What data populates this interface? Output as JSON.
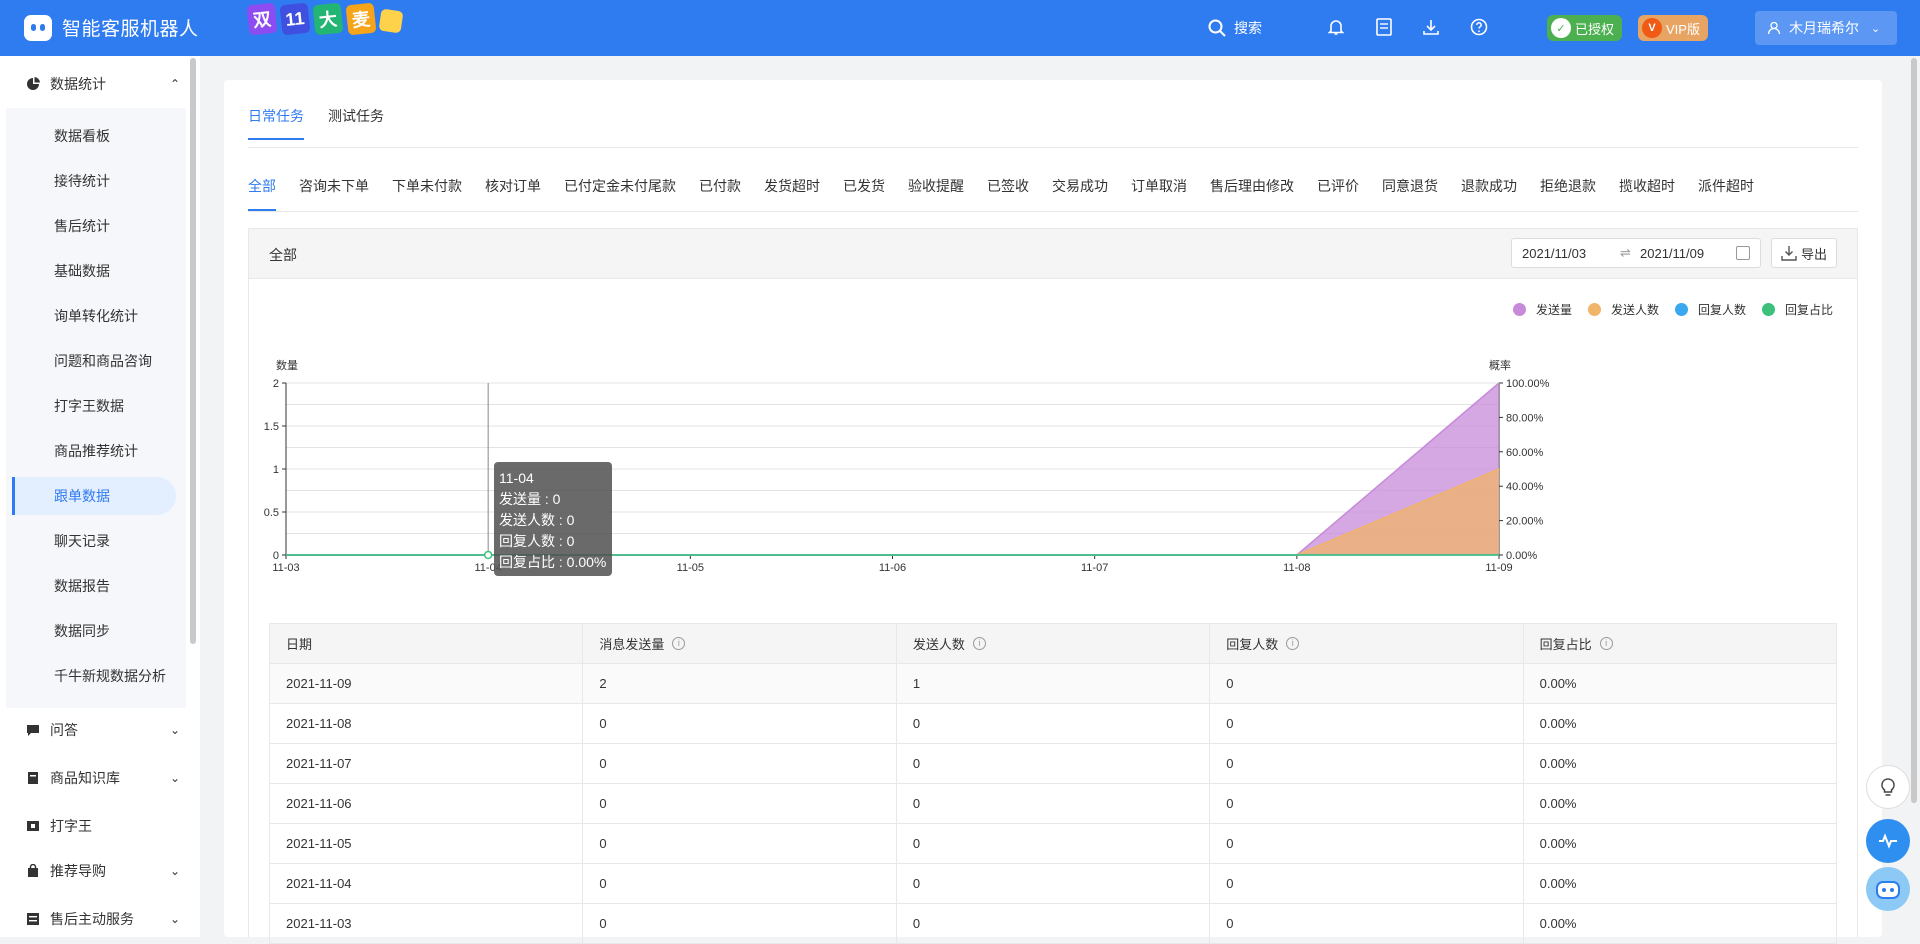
{
  "app": {
    "title": "智能客服机器人",
    "banner_chars": [
      "双",
      "11",
      "大",
      "麦"
    ]
  },
  "topbar": {
    "search_label": "搜索",
    "authorized_label": "已授权",
    "vip_label": "VIP版",
    "user_name": "木月瑞希尔"
  },
  "colors": {
    "primary": "#2f7bf0",
    "authorized": "#4caf50",
    "vip": "#f08c2e"
  },
  "sidebar": {
    "stats_group": "数据统计",
    "items": [
      "数据看板",
      "接待统计",
      "售后统计",
      "基础数据",
      "询单转化统计",
      "问题和商品咨询",
      "打字王数据",
      "商品推荐统计",
      "跟单数据",
      "聊天记录",
      "数据报告",
      "数据同步",
      "千牛新规数据分析"
    ],
    "active_index": 8,
    "groups": [
      "问答",
      "商品知识库",
      "打字王",
      "推荐导购",
      "售后主动服务"
    ]
  },
  "tabs_top": [
    "日常任务",
    "测试任务"
  ],
  "tabs_top_active": 0,
  "tabs_status": [
    "全部",
    "咨询未下单",
    "下单未付款",
    "核对订单",
    "已付定金未付尾款",
    "已付款",
    "发货超时",
    "已发货",
    "验收提醒",
    "已签收",
    "交易成功",
    "订单取消",
    "售后理由修改",
    "已评价",
    "同意退货",
    "退款成功",
    "拒绝退款",
    "揽收超时",
    "派件超时"
  ],
  "tabs_status_active": 0,
  "panel": {
    "title": "全部",
    "date_from": "2021/11/03",
    "date_to": "2021/11/09",
    "export_label": "导出"
  },
  "tooltip": {
    "title": "11-04",
    "lines": [
      "发送量 : 0",
      "发送人数 : 0",
      "回复人数 : 0",
      "回复占比 : 0.00%"
    ]
  },
  "chart_data": {
    "type": "area",
    "categories": [
      "11-03",
      "11-04",
      "11-05",
      "11-06",
      "11-07",
      "11-08",
      "11-09"
    ],
    "ylabel": "数量",
    "y2label": "概率",
    "ylim": [
      0,
      2
    ],
    "y2lim": [
      0,
      100
    ],
    "yticks": [
      "0",
      "0.5",
      "1",
      "1.5",
      "2"
    ],
    "y2ticks": [
      "0.00%",
      "20.00%",
      "40.00%",
      "60.00%",
      "80.00%",
      "100.00%"
    ],
    "legend_position": "top-right",
    "series": [
      {
        "name": "发送量",
        "color": "#c78ad9",
        "values": [
          0,
          0,
          0,
          0,
          0,
          0,
          2
        ],
        "axis": "left"
      },
      {
        "name": "发送人数",
        "color": "#f0b46a",
        "values": [
          0,
          0,
          0,
          0,
          0,
          0,
          1
        ],
        "axis": "left"
      },
      {
        "name": "回复人数",
        "color": "#3aa8f0",
        "values": [
          0,
          0,
          0,
          0,
          0,
          0,
          0
        ],
        "axis": "left"
      },
      {
        "name": "回复占比",
        "color": "#3cc07a",
        "values": [
          0,
          0,
          0,
          0,
          0,
          0,
          0
        ],
        "axis": "right"
      }
    ]
  },
  "table": {
    "headers": [
      "日期",
      "消息发送量",
      "发送人数",
      "回复人数",
      "回复占比"
    ],
    "rows": [
      [
        "2021-11-09",
        "2",
        "1",
        "0",
        "0.00%"
      ],
      [
        "2021-11-08",
        "0",
        "0",
        "0",
        "0.00%"
      ],
      [
        "2021-11-07",
        "0",
        "0",
        "0",
        "0.00%"
      ],
      [
        "2021-11-06",
        "0",
        "0",
        "0",
        "0.00%"
      ],
      [
        "2021-11-05",
        "0",
        "0",
        "0",
        "0.00%"
      ],
      [
        "2021-11-04",
        "0",
        "0",
        "0",
        "0.00%"
      ],
      [
        "2021-11-03",
        "0",
        "0",
        "0",
        "0.00%"
      ]
    ]
  }
}
